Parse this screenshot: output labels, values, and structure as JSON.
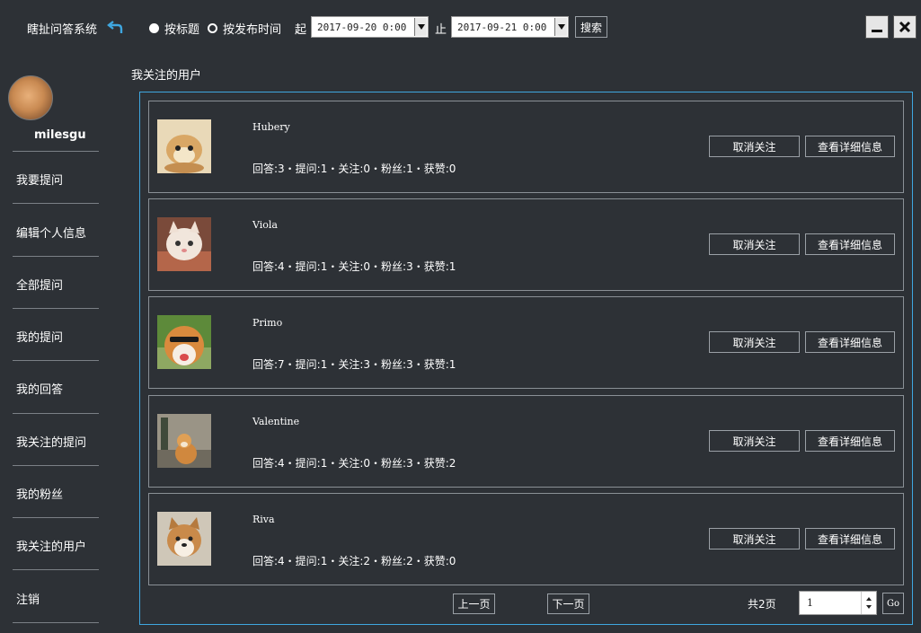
{
  "app": {
    "title": "瞎扯问答系统"
  },
  "search": {
    "radio_by_title": "按标题",
    "radio_by_time": "按发布时间",
    "from_label": "起",
    "from_value": "2017-09-20 0:00",
    "to_label": "止",
    "to_value": "2017-09-21 0:00",
    "search_button": "搜索"
  },
  "sidebar": {
    "username": "milesgu",
    "items": [
      {
        "label": "我要提问"
      },
      {
        "label": "编辑个人信息"
      },
      {
        "label": "全部提问"
      },
      {
        "label": "我的提问"
      },
      {
        "label": "我的回答"
      },
      {
        "label": "我关注的提问"
      },
      {
        "label": "我的粉丝"
      },
      {
        "label": "我关注的用户"
      },
      {
        "label": "注销"
      }
    ]
  },
  "main": {
    "section_title": "我关注的用户",
    "unfollow_label": "取消关注",
    "detail_label": "查看详细信息",
    "users": [
      {
        "name": "Hubery",
        "stats": "回答:3・提问:1・关注:0・粉丝:1・获赞:0"
      },
      {
        "name": "Viola",
        "stats": "回答:4・提问:1・关注:0・粉丝:3・获赞:1"
      },
      {
        "name": "Primo",
        "stats": "回答:7・提问:1・关注:3・粉丝:3・获赞:1"
      },
      {
        "name": "Valentine",
        "stats": "回答:4・提问:1・关注:0・粉丝:3・获赞:2"
      },
      {
        "name": "Riva",
        "stats": "回答:4・提问:1・关注:2・粉丝:2・获赞:0"
      }
    ]
  },
  "pager": {
    "prev": "上一页",
    "next": "下一页",
    "total": "共2页",
    "page_value": "1",
    "go": "Go"
  }
}
